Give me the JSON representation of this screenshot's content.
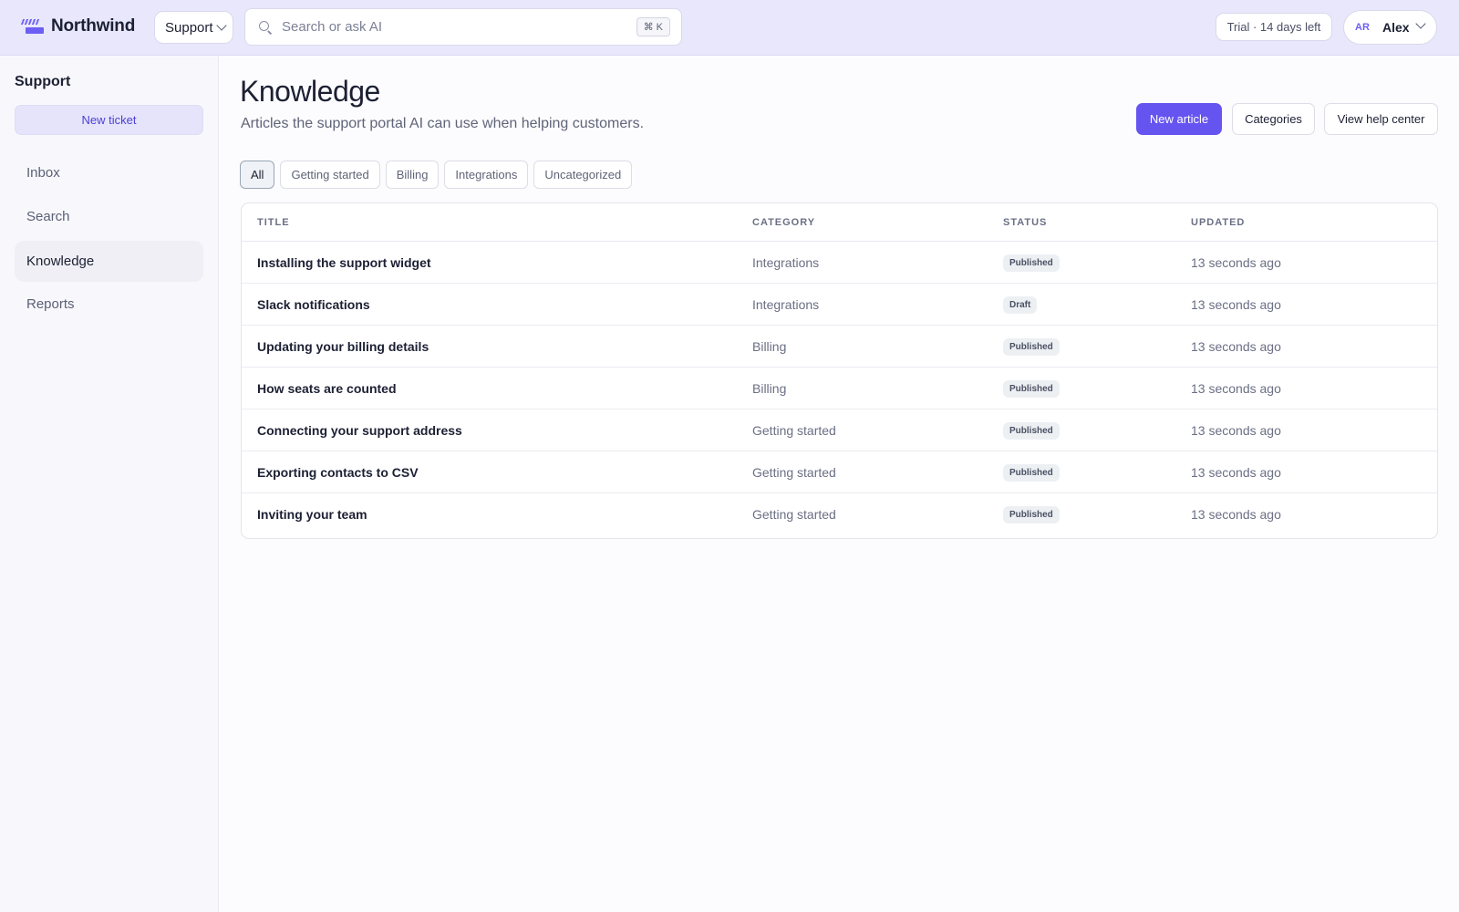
{
  "app": {
    "name": "Northwind",
    "accent": "#6654f1"
  },
  "topbar": {
    "workspace": "Support",
    "search_placeholder": "Search or ask AI",
    "search_shortcut": "⌘ K",
    "trial": "Trial · 14 days left",
    "user_initials": "AR",
    "user_name": "Alex"
  },
  "sidebar": {
    "title": "Support",
    "new_ticket": "New ticket",
    "items": [
      {
        "label": "Inbox",
        "active": false
      },
      {
        "label": "Search",
        "active": false
      },
      {
        "label": "Knowledge",
        "active": true
      },
      {
        "label": "Reports",
        "active": false
      }
    ]
  },
  "page": {
    "title": "Knowledge",
    "subtitle": "Articles the support portal AI can use when helping customers.",
    "actions": {
      "new_article": "New article",
      "categories": "Categories",
      "view_help_center": "View help center"
    },
    "filters": [
      {
        "label": "All",
        "active": true
      },
      {
        "label": "Getting started",
        "active": false
      },
      {
        "label": "Billing",
        "active": false
      },
      {
        "label": "Integrations",
        "active": false
      },
      {
        "label": "Uncategorized",
        "active": false
      }
    ]
  },
  "table": {
    "columns": [
      "TITLE",
      "CATEGORY",
      "STATUS",
      "UPDATED"
    ],
    "rows": [
      {
        "title": "Installing the support widget",
        "category": "Integrations",
        "status": "Published",
        "updated": "13 seconds ago"
      },
      {
        "title": "Slack notifications",
        "category": "Integrations",
        "status": "Draft",
        "updated": "13 seconds ago"
      },
      {
        "title": "Updating your billing details",
        "category": "Billing",
        "status": "Published",
        "updated": "13 seconds ago"
      },
      {
        "title": "How seats are counted",
        "category": "Billing",
        "status": "Published",
        "updated": "13 seconds ago"
      },
      {
        "title": "Connecting your support address",
        "category": "Getting started",
        "status": "Published",
        "updated": "13 seconds ago"
      },
      {
        "title": "Exporting contacts to CSV",
        "category": "Getting started",
        "status": "Published",
        "updated": "13 seconds ago"
      },
      {
        "title": "Inviting your team",
        "category": "Getting started",
        "status": "Published",
        "updated": "13 seconds ago"
      }
    ]
  }
}
